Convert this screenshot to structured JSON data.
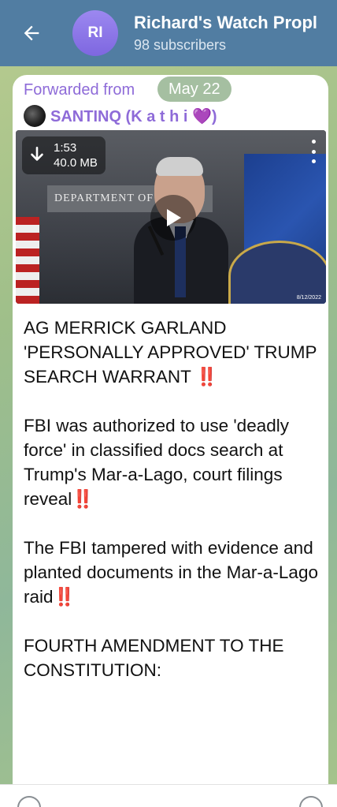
{
  "header": {
    "channel_title": "Richard's Watch Propl",
    "subscribers": "98 subscribers",
    "avatar_initials": "RI",
    "avatar_color": "#8b74ea",
    "bar_color": "#517da2"
  },
  "message": {
    "forwarded_label": "Forwarded from",
    "date_pill": "May 22",
    "source_name": "SANTINQ (K a t h i 💜)",
    "video": {
      "duration": "1:53",
      "size": "40.0 MB",
      "plaque_text": "DEPARTMENT OF JUSTICE",
      "date_stamp": "8/12/2022"
    },
    "paragraphs": [
      {
        "text": "AG MERRICK GARLAND 'PERSONALLY APPROVED' TRUMP SEARCH WARRANT",
        "suffix": "‼️"
      },
      {
        "text": "FBI was authorized to use 'deadly force' in classified docs search at Trump's Mar-a-Lago, court filings reveal",
        "suffix": "‼️"
      },
      {
        "text": "The FBI tampered with evidence and planted documents in the Mar-a-Lago raid",
        "suffix": "‼️"
      },
      {
        "text": "FOURTH AMENDMENT TO THE CONSTITUTION:",
        "suffix": ""
      }
    ]
  },
  "colors": {
    "forward_accent": "#8e6bd8",
    "exclamation": "#e3161e"
  }
}
